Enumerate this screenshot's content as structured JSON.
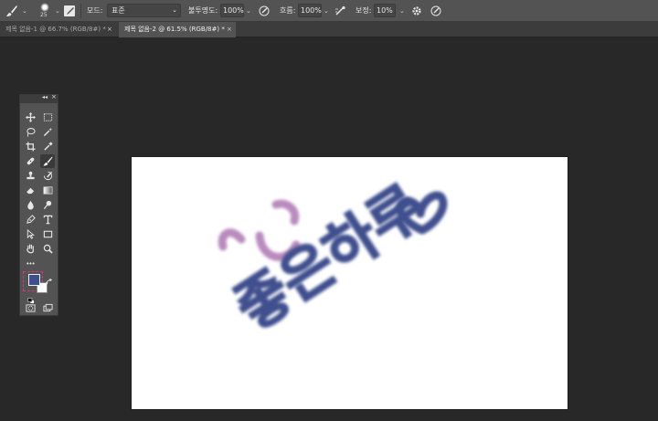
{
  "options_bar": {
    "brush_size": "25",
    "mode_label": "모드:",
    "mode_value": "표준",
    "opacity_label": "불투명도:",
    "opacity_value": "100%",
    "flow_label": "흐름:",
    "flow_value": "100%",
    "smoothing_label": "보정:",
    "smoothing_value": "10%"
  },
  "tabs": [
    {
      "label": "제목 없음-1 @ 66.7% (RGB/8#) *",
      "close": "×",
      "active": false
    },
    {
      "label": "제목 없음-2 @ 61.5% (RGB/8#) *",
      "close": "×",
      "active": true
    }
  ],
  "tools_panel": {
    "collapse": "◂◂",
    "close": "×",
    "more": "•••",
    "foreground_color": "#3f4f8e",
    "background_color": "#ffffff"
  },
  "canvas": {
    "artwork_text": "좋은하루",
    "text_color": "#3f4f8e",
    "smile_color": "#b98bbd"
  }
}
